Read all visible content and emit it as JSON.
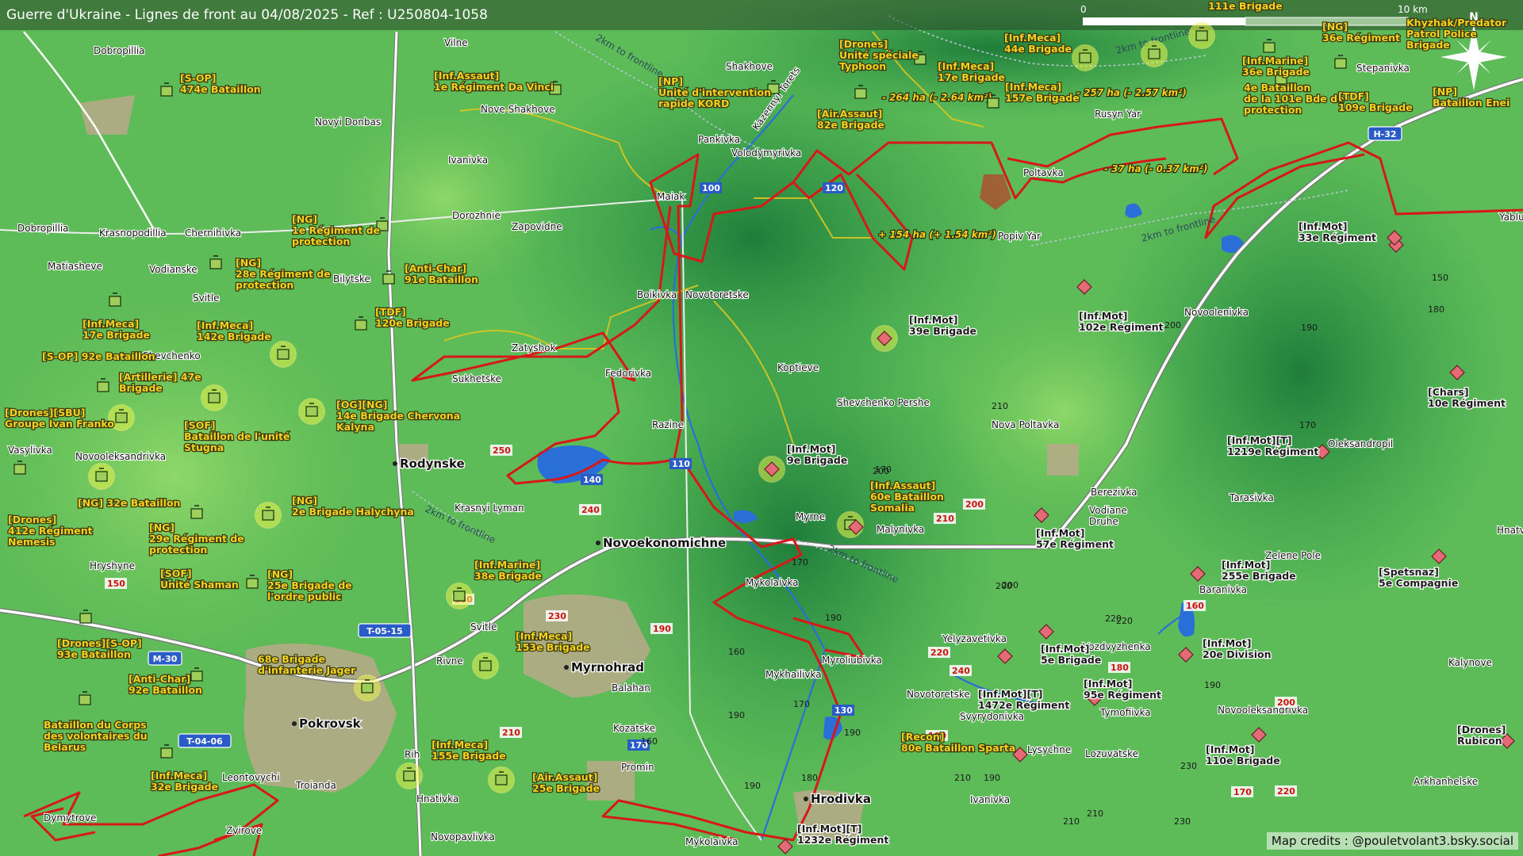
{
  "header": {
    "title": "Guerre d'Ukraine - Lignes de front au 04/08/2025 - Ref : U250804-1058"
  },
  "scale": {
    "start": "0",
    "end": "10 km"
  },
  "north": "N",
  "credits": "Map credits : @pouletvolant3.bsky.social",
  "colors": {
    "ukraine": "#f4d21f",
    "russia": "#e05a6a",
    "frontline": "#d81818",
    "road": "#ffffff"
  },
  "towns": [
    {
      "id": "dobropillia",
      "label": "Dobropillia",
      "size": "town"
    },
    {
      "id": "vilne",
      "label": "Vilne",
      "size": "town"
    },
    {
      "id": "novyi-donbas",
      "label": "Novyi Donbas",
      "size": "town"
    },
    {
      "id": "nove-shakhove",
      "label": "Nove Shakhove",
      "size": "town"
    },
    {
      "id": "shakhove",
      "label": "Shakhove",
      "size": "town"
    },
    {
      "id": "ivanivka",
      "label": "Ivanivka",
      "size": "town"
    },
    {
      "id": "pankivka",
      "label": "Pankivka",
      "size": "town"
    },
    {
      "id": "volodymyrivka",
      "label": "Volodymyrivka",
      "size": "town"
    },
    {
      "id": "dorozhnie",
      "label": "Dorozhnie",
      "size": "town"
    },
    {
      "id": "maiak",
      "label": "Maiak",
      "size": "town"
    },
    {
      "id": "zapovidne",
      "label": "Zapovidne",
      "size": "town"
    },
    {
      "id": "dobropillia2",
      "label": "Dobropillia",
      "size": "town"
    },
    {
      "id": "krasnopodillia",
      "label": "Krasnopodillia",
      "size": "town"
    },
    {
      "id": "chernihivka",
      "label": "Chernihivka",
      "size": "town"
    },
    {
      "id": "matiasheve",
      "label": "Matiasheve",
      "size": "town"
    },
    {
      "id": "vodianske",
      "label": "Vodianske",
      "size": "town"
    },
    {
      "id": "svitle",
      "label": "Svitle",
      "size": "town"
    },
    {
      "id": "bilytske",
      "label": "Bilytske",
      "size": "town"
    },
    {
      "id": "boikivka",
      "label": "Boikivka",
      "size": "town"
    },
    {
      "id": "novotoretske",
      "label": "Novotoretske",
      "size": "town"
    },
    {
      "id": "shevchenko",
      "label": "Shevchenko",
      "size": "town"
    },
    {
      "id": "zatyshok",
      "label": "Zatyshok",
      "size": "town"
    },
    {
      "id": "sukhetske",
      "label": "Sukhetske",
      "size": "town"
    },
    {
      "id": "fedorivka",
      "label": "Fedorivka",
      "size": "town"
    },
    {
      "id": "koptieve",
      "label": "Koptieve",
      "size": "town"
    },
    {
      "id": "shevchenko-pershe",
      "label": "Shevchenko Pershe",
      "size": "town"
    },
    {
      "id": "razine",
      "label": "Razine",
      "size": "town"
    },
    {
      "id": "vasylivka",
      "label": "Vasylivka",
      "size": "town"
    },
    {
      "id": "novooleksandrivka",
      "label": "Novooleksandrivka",
      "size": "town"
    },
    {
      "id": "rodynske",
      "label": "Rodynske",
      "size": "city"
    },
    {
      "id": "krasnyi-lyman",
      "label": "Krasnyi Lyman",
      "size": "town"
    },
    {
      "id": "novoekonomichne",
      "label": "Novoekonomichne",
      "size": "city"
    },
    {
      "id": "myrne",
      "label": "Myrne",
      "size": "town"
    },
    {
      "id": "malynivka",
      "label": "Malynivka",
      "size": "town"
    },
    {
      "id": "hryshyne",
      "label": "Hryshyne",
      "size": "town"
    },
    {
      "id": "svitle2",
      "label": "Svitle",
      "size": "town"
    },
    {
      "id": "mykolaivka",
      "label": "Mykolaivka",
      "size": "town"
    },
    {
      "id": "rivne",
      "label": "Rivne",
      "size": "town"
    },
    {
      "id": "myrnohrad",
      "label": "Myrnohrad",
      "size": "city"
    },
    {
      "id": "myroliubivka",
      "label": "Myroliubivka",
      "size": "town"
    },
    {
      "id": "balahan",
      "label": "Balahan",
      "size": "town"
    },
    {
      "id": "mykhailivka",
      "label": "Mykhailivka",
      "size": "town"
    },
    {
      "id": "pokrovsk",
      "label": "Pokrovsk",
      "size": "city"
    },
    {
      "id": "kozatske",
      "label": "Kozatske",
      "size": "town"
    },
    {
      "id": "promin",
      "label": "Promin",
      "size": "town"
    },
    {
      "id": "leontovychi",
      "label": "Leontovychi",
      "size": "town"
    },
    {
      "id": "troianda",
      "label": "Troianda",
      "size": "town"
    },
    {
      "id": "rih",
      "label": "Rih",
      "size": "town"
    },
    {
      "id": "hnativka",
      "label": "Hnativka",
      "size": "town"
    },
    {
      "id": "dymytrove",
      "label": "Dymytrove",
      "size": "town"
    },
    {
      "id": "zvirove",
      "label": "Zvirove",
      "size": "town"
    },
    {
      "id": "novopavlivka",
      "label": "Novopavlivka",
      "size": "town"
    },
    {
      "id": "mykolaivka2",
      "label": "Mykolaivka",
      "size": "town"
    },
    {
      "id": "hrodivka",
      "label": "Hrodivka",
      "size": "city"
    },
    {
      "id": "novotoretske2",
      "label": "Novotoretske",
      "size": "town"
    },
    {
      "id": "svyrydonivka",
      "label": "Svyrydonivka",
      "size": "town"
    },
    {
      "id": "yelyzavetivka",
      "label": "Yelyzavetivka",
      "size": "town"
    },
    {
      "id": "lysychne",
      "label": "Lysychne",
      "size": "town"
    },
    {
      "id": "ivanivka2",
      "label": "Ivanivka",
      "size": "town"
    },
    {
      "id": "rusyn-yar",
      "label": "Rusyn Yar",
      "size": "town"
    },
    {
      "id": "stepanivka",
      "label": "Stepanivka",
      "size": "town"
    },
    {
      "id": "poltavka",
      "label": "Poltavka",
      "size": "town"
    },
    {
      "id": "popiv-yar",
      "label": "Popiv Yar",
      "size": "town"
    },
    {
      "id": "novoolenivka",
      "label": "Novoolenivka",
      "size": "town"
    },
    {
      "id": "nova-poltavka",
      "label": "Nova Poltavka",
      "size": "town"
    },
    {
      "id": "berezivka",
      "label": "Berezivka",
      "size": "town"
    },
    {
      "id": "vodiane-druhe",
      "label": "Vodiane\nDruhe",
      "size": "town"
    },
    {
      "id": "tarasivka",
      "label": "Tarasivka",
      "size": "town"
    },
    {
      "id": "oleksandropil",
      "label": "Oleksandropil",
      "size": "town"
    },
    {
      "id": "zelene-pole",
      "label": "Zelene Pole",
      "size": "town"
    },
    {
      "id": "baranivka",
      "label": "Baranivka",
      "size": "town"
    },
    {
      "id": "vozdvyzhenka",
      "label": "Vozdvyzhenka",
      "size": "town"
    },
    {
      "id": "tymofiivka",
      "label": "Tymofiivka",
      "size": "town"
    },
    {
      "id": "lozuvatske",
      "label": "Lozuvatske",
      "size": "town"
    },
    {
      "id": "novooleksandrivka2",
      "label": "Novooleksandrivka",
      "size": "town"
    },
    {
      "id": "kalynove",
      "label": "Kalynove",
      "size": "town"
    },
    {
      "id": "arkhanhelske",
      "label": "Arkhanhelske",
      "size": "town"
    },
    {
      "id": "hnatvka",
      "label": "Hnatv",
      "size": "town"
    },
    {
      "id": "yablu",
      "label": "Yablu",
      "size": "town"
    },
    {
      "id": "kazennyi-torets",
      "label": "Kazennyi Torets",
      "size": "town"
    }
  ],
  "ua_units": [
    [
      "[S-OP]",
      "474e Bataillon"
    ],
    [
      "[Inf.Assaut]",
      "1e Régiment Da Vinci"
    ],
    [
      "[NP]",
      "Unité d'intervention",
      "rapide KORD"
    ],
    [
      "[Drones]",
      "Unité spéciale",
      "Typhoon"
    ],
    [
      "[Air.Assaut]",
      "82e Brigade"
    ],
    [
      "[Inf.Meca]",
      "17e Brigade"
    ],
    [
      "[Inf.Meca]",
      "44e Brigade"
    ],
    [
      "[Inf.Meca]",
      "157e Brigade"
    ],
    [
      "[Inf.Marine]",
      "36e Brigade"
    ],
    [
      "[NG]",
      "36e Régiment"
    ],
    [
      "Khyzhak/Predator",
      "Patrol Police",
      "Brigade"
    ],
    [
      "4e Bataillon",
      "de la 101e Bde de",
      "protection"
    ],
    [
      "[TDF]",
      "109e Brigade"
    ],
    [
      "[NP]",
      "Bataillon Enei"
    ],
    [
      "[NG]",
      "1e Régiment de",
      "protection"
    ],
    [
      "[NG]",
      "28e Régiment de",
      "protection"
    ],
    [
      "[Anti-Char]",
      "91e Bataillon"
    ],
    [
      "[TDF]",
      "120e Brigade"
    ],
    [
      "[Inf.Meca]",
      "17e Brigade"
    ],
    [
      "[Inf.Meca]",
      "142e Brigade"
    ],
    [
      "[S-OP] 92e Bataillon"
    ],
    [
      "[Artillerie] 47e",
      "Brigade"
    ],
    [
      "[Drones][SBU]",
      "Groupe Ivan Franko"
    ],
    [
      "[SOF]",
      "Bataillon de l'unité",
      "Stugna"
    ],
    [
      "[OG][NG]",
      "14e Brigade Chervona",
      "Kalyna"
    ],
    [
      "[NG] 32e Bataillon"
    ],
    [
      "[NG]",
      "2e Brigade Halychyna"
    ],
    [
      "[Drones]",
      "412e Régiment",
      "Nemesis"
    ],
    [
      "[NG]",
      "29e Régiment de",
      "protection"
    ],
    [
      "[SOF]",
      "Unité Shaman"
    ],
    [
      "[NG]",
      "25e Brigade de",
      "l'ordre public"
    ],
    [
      "[Inf.Marine]",
      "38e Brigade"
    ],
    [
      "[Drones][S-OP]",
      "93e Bataillon"
    ],
    [
      "68e Brigade",
      "d'infanterie Jager"
    ],
    [
      "[Inf.Meca]",
      "153e Brigade"
    ],
    [
      "[Anti-Char]",
      "92e Bataillon"
    ],
    [
      "Bataillon du Corps",
      "des volontaires du",
      "Belarus"
    ],
    [
      "[Inf.Meca]",
      "155e Brigade"
    ],
    [
      "[Inf.Meca]",
      "32e Brigade"
    ],
    [
      "[Air.Assaut]",
      "25e Brigade"
    ],
    [
      "[Recon]",
      "80e Bataillon Sparta"
    ],
    [
      "[Inf.Assaut]",
      "60e Bataillon",
      "Somalia"
    ]
  ],
  "ru_units": [
    [
      "[Inf.Mot]",
      "39e Brigade"
    ],
    [
      "[Inf.Mot]",
      "102e Régiment"
    ],
    [
      "[Inf.Mot]",
      "33e Régiment"
    ],
    [
      "[Chars]",
      "10e Régiment"
    ],
    [
      "[Inf.Mot]",
      "9e Brigade"
    ],
    [
      "[Inf.Mot][T]",
      "1219e Régiment"
    ],
    [
      "[Inf.Mot]",
      "57e Régiment"
    ],
    [
      "[Inf.Mot]",
      "255e Brigade"
    ],
    [
      "[Spetsnaz]",
      "5e Compagnie"
    ],
    [
      "[Inf.Mot]",
      "5e Brigade"
    ],
    [
      "[Inf.Mot][T]",
      "1472e Régiment"
    ],
    [
      "[Inf.Mot]",
      "95e Régiment"
    ],
    [
      "[Inf.Mot]",
      "20e Division"
    ],
    [
      "[Inf.Mot]",
      "110e Brigade"
    ],
    [
      "[Drones]",
      "Rubicon"
    ],
    [
      "[Inf.Mot][T]",
      "1232e Régiment"
    ]
  ],
  "annotations": [
    "- 264 ha (- 2.64 km²)",
    "- 257 ha (- 2.57 km²)",
    "- 37 ha (- 0.37 km²)",
    "+ 154 ha (+ 1.54 km²)"
  ],
  "frontline_labels": [
    "2km to frontline",
    "2km to frontline",
    "2km to frontline",
    "2km to frontline",
    "2km to frontline"
  ],
  "roads": [
    "M-30",
    "T-05-15",
    "T-04-06",
    "H-32"
  ],
  "road_numbers": [
    "100",
    "120",
    "110",
    "140",
    "130",
    "170",
    "210",
    "250",
    "240",
    "230",
    "190",
    "220",
    "200",
    "160",
    "150",
    "180",
    "230",
    "210",
    "220",
    "200",
    "240",
    "170",
    "190"
  ],
  "elevations": [
    "210",
    "170",
    "150",
    "180",
    "190",
    "200",
    "200",
    "170",
    "160",
    "190",
    "170",
    "180",
    "190",
    "190",
    "220",
    "210",
    "230",
    "210",
    "230",
    "200",
    "170",
    "190",
    "210",
    "190",
    "190",
    "160",
    "200",
    "220"
  ],
  "top_partial": [
    "111e Brigade"
  ]
}
